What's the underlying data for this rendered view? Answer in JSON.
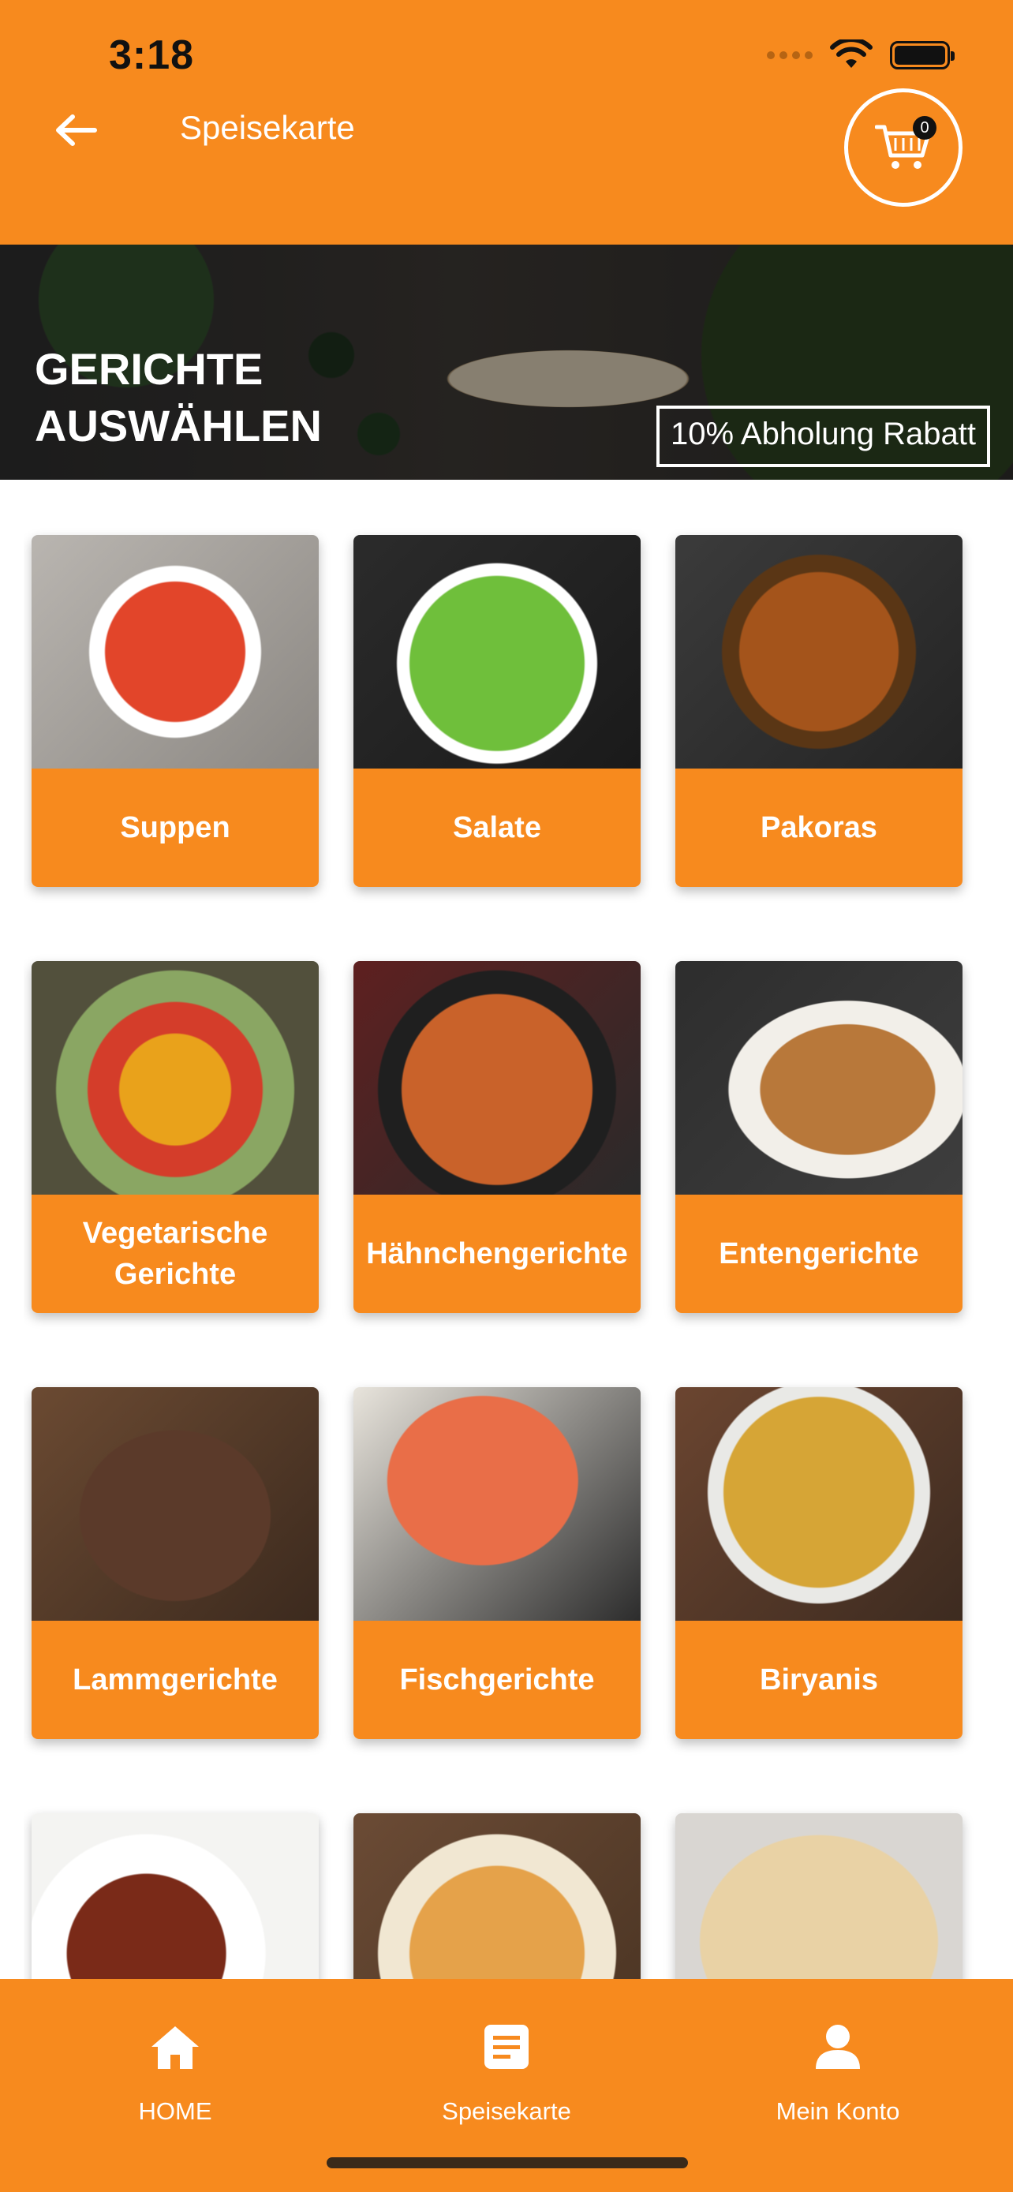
{
  "status_bar": {
    "time": "3:18"
  },
  "header": {
    "title": "Speisekarte",
    "cart_count": "0"
  },
  "banner": {
    "title": "GERICHTE AUSWÄHLEN",
    "discount": "10% Abholung Rabatt"
  },
  "categories": [
    {
      "label": "Suppen"
    },
    {
      "label": "Salate"
    },
    {
      "label": "Pakoras"
    },
    {
      "label": "Vegetarische Gerichte"
    },
    {
      "label": "Hähnchengerichte"
    },
    {
      "label": "Entengerichte"
    },
    {
      "label": "Lammgerichte"
    },
    {
      "label": "Fischgerichte"
    },
    {
      "label": "Biryanis"
    },
    {
      "label": ""
    },
    {
      "label": ""
    },
    {
      "label": ""
    }
  ],
  "bottom_nav": {
    "items": [
      {
        "label": "HOME",
        "icon": "home-icon"
      },
      {
        "label": "Speisekarte",
        "icon": "menu-icon"
      },
      {
        "label": "Mein Konto",
        "icon": "account-icon"
      }
    ]
  },
  "colors": {
    "accent": "#F78A1E",
    "text_on_accent": "#FFFFFF"
  }
}
